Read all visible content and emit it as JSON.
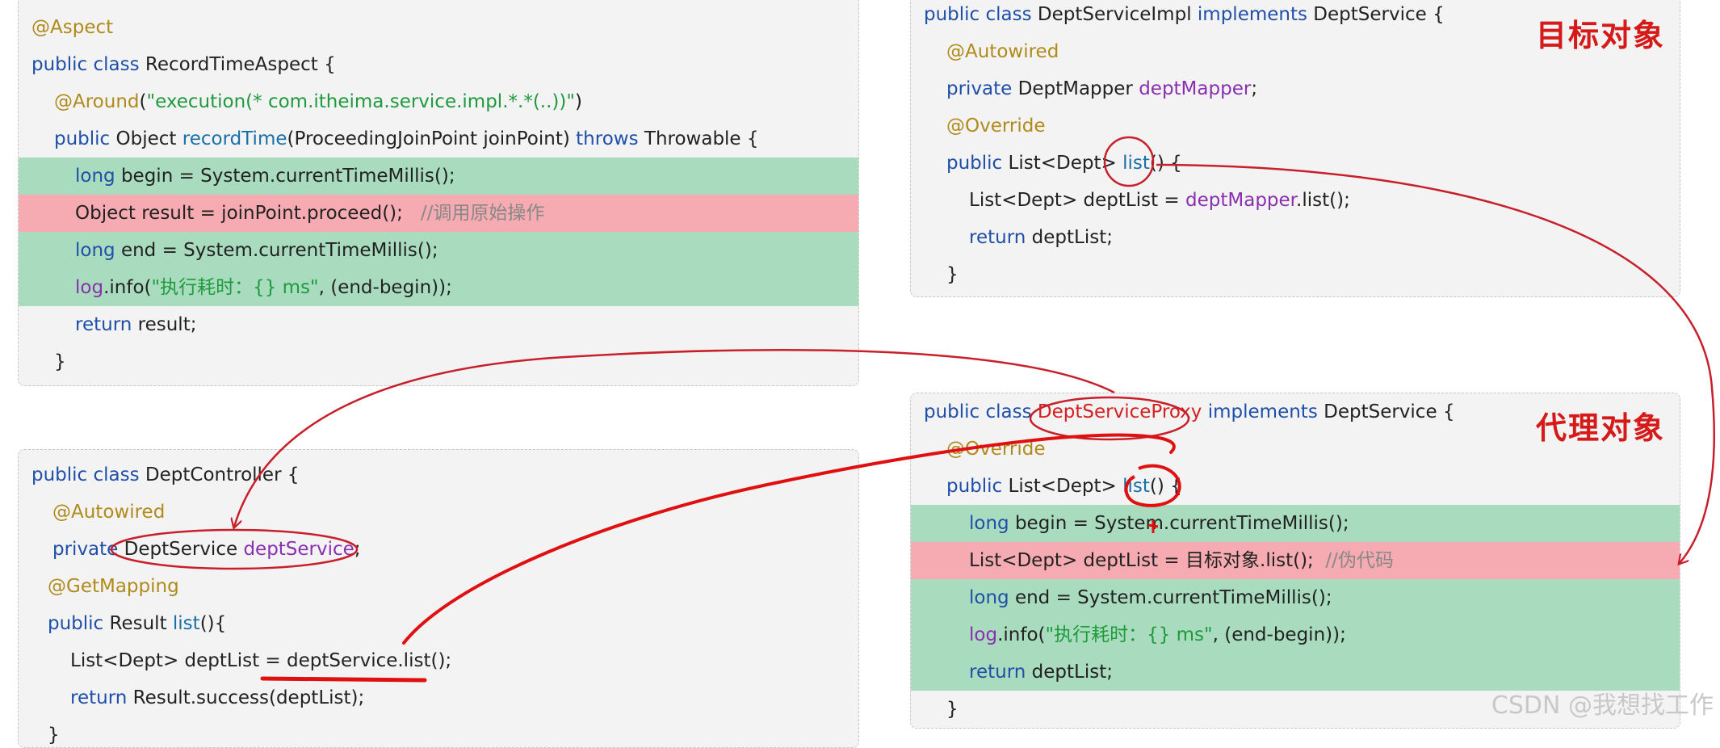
{
  "aspect": {
    "annotation": "@Aspect",
    "cls_kw": "public class",
    "cls_name": "RecordTimeAspect {",
    "around_ann": "@Around",
    "around_open": "(",
    "around_str": "\"execution(* com.itheima.service.impl.*.*(..))\"",
    "around_close": ")",
    "m_kw": "public",
    "m_type": "Object",
    "m_name": "recordTime",
    "m_params": "(ProceedingJoinPoint joinPoint)",
    "m_throws": "throws",
    "m_exc": "Throwable {",
    "l1_kw": "long",
    "l1_rest": "begin = System.currentTimeMillis();",
    "l2_code": "Object result = joinPoint.proceed();",
    "l2_cmt": "//调用原始操作",
    "l3_kw": "long",
    "l3_rest": "end = System.currentTimeMillis();",
    "l4_log": "log",
    "l4_a": ".info(",
    "l4_str": "\"执行耗时：{} ms\"",
    "l4_b": ", (end-begin));",
    "ret_kw": "return",
    "ret_rest": "result;",
    "close": "}"
  },
  "impl": {
    "cls_kw": "public class",
    "cls_name": "DeptServiceImpl",
    "impl_kw": "implements",
    "iface": "DeptService {",
    "autowired": "@Autowired",
    "f_kw": "private",
    "f_type": "DeptMapper",
    "f_name": "deptMapper",
    "f_semi": ";",
    "override": "@Override",
    "m_kw": "public",
    "m_type": "List<Dept>",
    "m_name": "list",
    "m_rest": "() {",
    "b_type": "List<Dept> deptList =",
    "b_field": "deptMapper",
    "b_rest": ".list();",
    "ret_kw": "return",
    "ret_rest": "deptList;",
    "close": "}"
  },
  "controller": {
    "cls_kw": "public class",
    "cls_name": "DeptController {",
    "autowired": "@Autowired",
    "f_kw": "private",
    "f_type": "DeptService",
    "f_name": "deptService",
    "f_semi": ";",
    "getmapping": "@GetMapping",
    "m_kw": "public",
    "m_type": "Result",
    "m_name": "list",
    "m_rest": "(){",
    "b_code": "List<Dept> deptList = deptService.list();",
    "ret_kw": "return",
    "ret_rest": "Result.success(deptList);",
    "close": "}"
  },
  "proxy": {
    "cls_kw": "public class",
    "cls_name": "DeptServiceProxy",
    "impl_kw": "implements",
    "iface": "DeptService {",
    "override": "@Override",
    "m_kw": "public",
    "m_type": "List<Dept>",
    "m_name": "list",
    "m_rest": "() {",
    "l1_kw": "long",
    "l1_rest": "begin = System.currentTimeMillis();",
    "l2_code": "List<Dept> deptList = 目标对象.list();",
    "l2_cmt": "//伪代码",
    "l3_kw": "long",
    "l3_rest": "end = System.currentTimeMillis();",
    "l4_log": "log",
    "l4_a": ".info(",
    "l4_str": "\"执行耗时：{} ms\"",
    "l4_b": ", (end-begin));",
    "ret_kw": "return",
    "ret_rest": "deptList;",
    "close": "}"
  },
  "labels": {
    "target": "目标对象",
    "proxy": "代理对象"
  },
  "watermark": "CSDN @我想找工作",
  "colors": {
    "keyword": "#1f4fa8",
    "annotation": "#b08a1a",
    "string": "#1f9a3d",
    "field": "#8a2fb0",
    "highlight_green": "#a9dcbe",
    "highlight_red": "#f6aab1",
    "marker_red": "#d42020"
  }
}
